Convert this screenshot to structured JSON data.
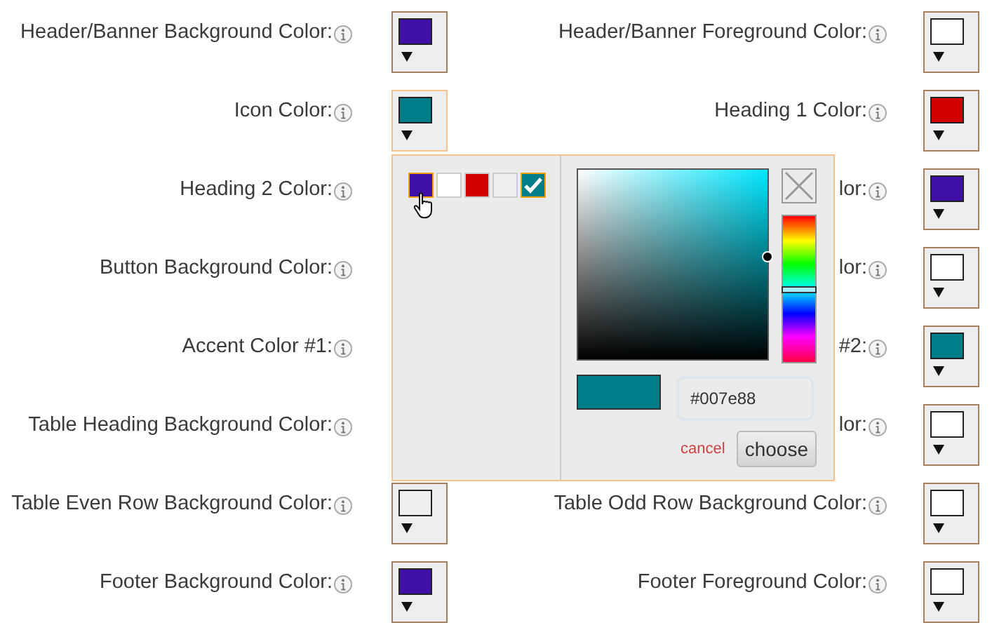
{
  "rows": [
    {
      "left": {
        "label": "Header/Banner Background Color:",
        "swatch": {
          "color": "#3f10a6",
          "active": false
        }
      },
      "right": {
        "label": "Header/Banner Foreground Color:",
        "swatch": {
          "color": "#ffffff",
          "active": false
        }
      }
    },
    {
      "left": {
        "label": "Icon Color:",
        "swatch": {
          "color": "#007e88",
          "active": true
        }
      },
      "right": {
        "label": "Heading 1 Color:",
        "swatch": {
          "color": "#d40000",
          "active": false
        }
      }
    },
    {
      "left": {
        "label": "Heading 2 Color:"
      },
      "right": {
        "label": "lor:",
        "swatch": {
          "color": "#3f10a6",
          "active": false
        }
      }
    },
    {
      "left": {
        "label": "Button Background Color:"
      },
      "right": {
        "label": "lor:",
        "swatch": {
          "color": "#ffffff",
          "active": false
        }
      }
    },
    {
      "left": {
        "label": "Accent Color #1:"
      },
      "right": {
        "label": "#2:",
        "swatch": {
          "color": "#007e88",
          "active": false
        }
      }
    },
    {
      "left": {
        "label": "Table Heading Background Color:"
      },
      "right": {
        "label": "lor:",
        "swatch": {
          "color": "#ffffff",
          "active": false
        }
      }
    },
    {
      "left": {
        "label": "Table Even Row Background Color:",
        "swatch": {
          "color": "#eeeeee",
          "active": false
        }
      },
      "right": {
        "label": "Table Odd Row Background Color:",
        "swatch": {
          "color": "#ffffff",
          "active": false
        }
      }
    },
    {
      "left": {
        "label": "Footer Background Color:",
        "swatch": {
          "color": "#3f10a6",
          "active": false
        }
      },
      "right": {
        "label": "Footer Foreground Color:",
        "swatch": {
          "color": "#ffffff",
          "active": false
        }
      }
    }
  ],
  "picker": {
    "palette": [
      {
        "color": "#3f10a6",
        "selected": false,
        "hovered": true
      },
      {
        "color": "#ffffff",
        "selected": false,
        "hovered": false
      },
      {
        "color": "#d40000",
        "selected": false,
        "hovered": false
      },
      {
        "color": "#eeeeee",
        "selected": false,
        "hovered": false
      },
      {
        "color": "#007e88",
        "selected": true,
        "hovered": false
      }
    ],
    "hue_slider": {
      "level": 0.5
    },
    "hex_field": {
      "value": "#007e88"
    },
    "cancel": "cancel",
    "choose": "choose"
  }
}
